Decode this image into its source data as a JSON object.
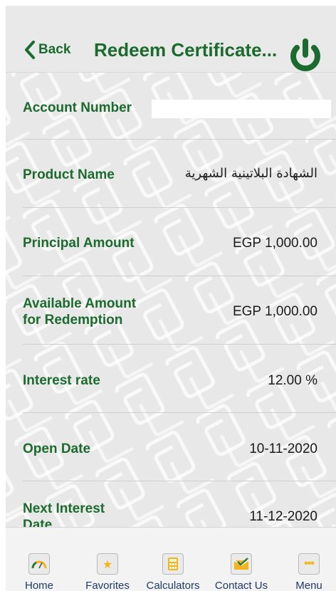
{
  "nav": {
    "back_label": "Back",
    "title": "Redeem Certificate...",
    "power_icon": "power-icon"
  },
  "colors": {
    "brand_green": "#1c6b2e",
    "tab_text": "#1f3a66",
    "tab_accent": "#f2b51b"
  },
  "details": {
    "account_number_label": "Account Number",
    "account_number_value": "",
    "product_name_label": "Product Name",
    "product_name_value": "الشهادة البلاتينية الشهرية",
    "principal_amount_label": "Principal Amount",
    "principal_amount_value": "EGP 1,000.00",
    "available_amount_label_line1": "Available Amount",
    "available_amount_label_line2": "for Redemption",
    "available_amount_value": "EGP 1,000.00",
    "interest_rate_label": "Interest rate",
    "interest_rate_value": "12.00 %",
    "open_date_label": "Open Date",
    "open_date_value": "10-11-2020",
    "next_interest_date_label_line1": "Next Interest",
    "next_interest_date_label_line2": "Date",
    "next_interest_date_value": "11-12-2020"
  },
  "tabs": [
    {
      "label": "Home",
      "icon": "speedometer-icon"
    },
    {
      "label": "Favorites",
      "icon": "star-icon"
    },
    {
      "label": "Calculators",
      "icon": "calculator-icon"
    },
    {
      "label": "Contact Us",
      "icon": "envelope-check-icon"
    },
    {
      "label": "Menu",
      "icon": "more-dots-icon"
    }
  ]
}
